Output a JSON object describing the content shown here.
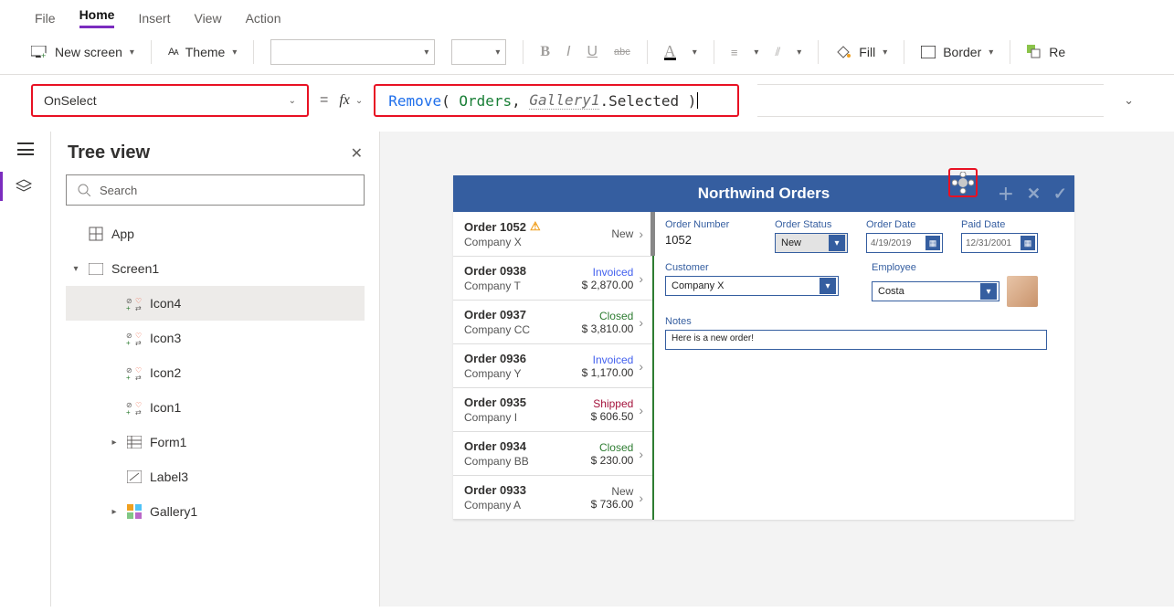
{
  "menu": {
    "file": "File",
    "home": "Home",
    "insert": "Insert",
    "view": "View",
    "action": "Action"
  },
  "ribbon": {
    "newscreen": "New screen",
    "theme": "Theme",
    "fill": "Fill",
    "border": "Border",
    "re": "Re"
  },
  "property": {
    "name": "OnSelect"
  },
  "formula": {
    "fn": "Remove",
    "arg1": "Orders",
    "gal": "Gallery1",
    "suffix": ".Selected"
  },
  "tree": {
    "title": "Tree view",
    "search_ph": "Search",
    "app": "App",
    "screen": "Screen1",
    "items": [
      "Icon4",
      "Icon3",
      "Icon2",
      "Icon1",
      "Form1",
      "Label3",
      "Gallery1"
    ]
  },
  "app": {
    "title": "Northwind Orders",
    "orders": [
      {
        "id": "Order 1052",
        "cust": "Company X",
        "status": "New",
        "statusCls": "stat-new",
        "amount": "",
        "warn": true
      },
      {
        "id": "Order 0938",
        "cust": "Company T",
        "status": "Invoiced",
        "statusCls": "stat-inv",
        "amount": "$ 2,870.00"
      },
      {
        "id": "Order 0937",
        "cust": "Company CC",
        "status": "Closed",
        "statusCls": "stat-closed",
        "amount": "$ 3,810.00"
      },
      {
        "id": "Order 0936",
        "cust": "Company Y",
        "status": "Invoiced",
        "statusCls": "stat-inv",
        "amount": "$ 1,170.00"
      },
      {
        "id": "Order 0935",
        "cust": "Company I",
        "status": "Shipped",
        "statusCls": "stat-ship",
        "amount": "$ 606.50"
      },
      {
        "id": "Order 0934",
        "cust": "Company BB",
        "status": "Closed",
        "statusCls": "stat-closed",
        "amount": "$ 230.00"
      },
      {
        "id": "Order 0933",
        "cust": "Company A",
        "status": "New",
        "statusCls": "stat-new",
        "amount": "$ 736.00"
      }
    ],
    "form": {
      "ordnum_l": "Order Number",
      "ordnum": "1052",
      "status_l": "Order Status",
      "status": "New",
      "odate_l": "Order Date",
      "odate": "4/19/2019",
      "pdate_l": "Paid Date",
      "pdate": "12/31/2001",
      "cust_l": "Customer",
      "cust": "Company X",
      "emp_l": "Employee",
      "emp": "Costa",
      "notes_l": "Notes",
      "notes": "Here is a new order!"
    }
  }
}
